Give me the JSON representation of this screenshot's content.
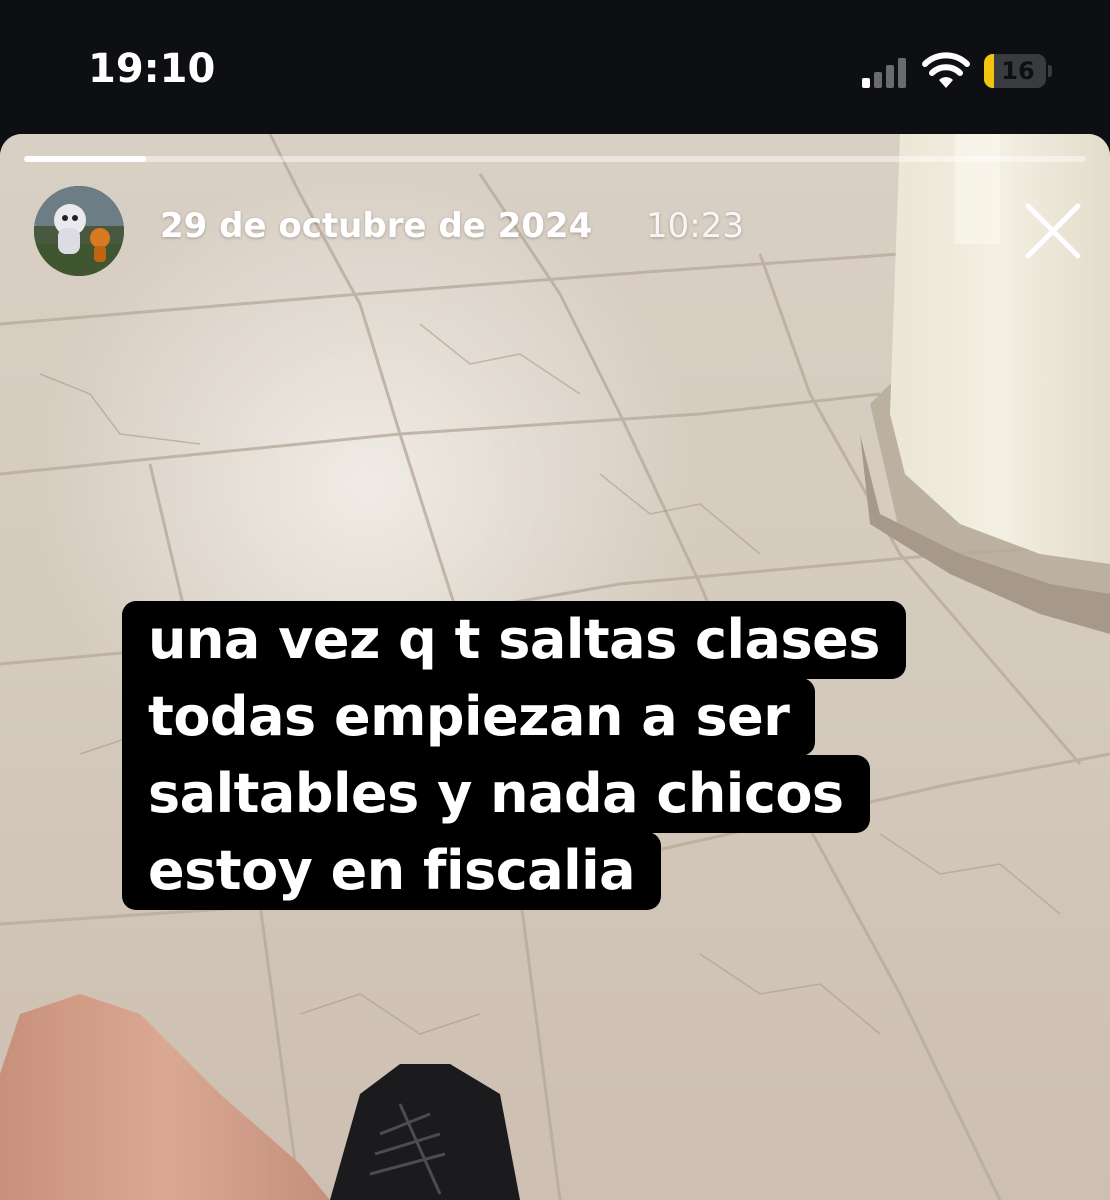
{
  "status_bar": {
    "time": "19:10",
    "battery_level": "16",
    "battery_fraction": 0.16,
    "signal_icon": "cellular-signal-icon",
    "wifi_icon": "wifi-icon"
  },
  "story": {
    "date": "29 de octubre de 2024",
    "time": "10:23",
    "progress_fraction": 0.115,
    "close_icon": "close-icon",
    "caption_lines": [
      "una vez q t saltas clases",
      "todas empiezan a ser",
      "saltables y nada chicos",
      "estoy en fiscalia"
    ]
  },
  "colors": {
    "status_bar_bg": "#0e0f13",
    "battery_fill": "#f2c40c",
    "caption_bg": "#000000",
    "caption_text": "#ffffff"
  }
}
